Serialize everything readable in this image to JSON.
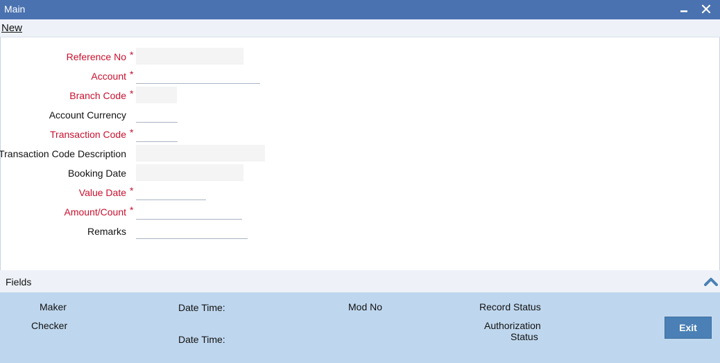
{
  "window": {
    "title": "Main",
    "minimize_icon": "minimize-icon",
    "close_icon": "close-icon"
  },
  "toolbar": {
    "new_label": "New"
  },
  "form": {
    "reference_no": {
      "label": "Reference No",
      "required": true,
      "value": ""
    },
    "account": {
      "label": "Account",
      "required": true,
      "value": ""
    },
    "branch_code": {
      "label": "Branch Code",
      "required": true,
      "value": ""
    },
    "account_currency": {
      "label": "Account Currency",
      "required": false,
      "value": ""
    },
    "transaction_code": {
      "label": "Transaction Code",
      "required": true,
      "value": ""
    },
    "transaction_code_description": {
      "label": "Transaction Code Description",
      "required": false,
      "value": ""
    },
    "booking_date": {
      "label": "Booking Date",
      "required": false,
      "value": ""
    },
    "value_date": {
      "label": "Value Date",
      "required": true,
      "value": ""
    },
    "amount_count": {
      "label": "Amount/Count",
      "required": true,
      "value": ""
    },
    "remarks": {
      "label": "Remarks",
      "required": false,
      "value": ""
    },
    "required_mark": "*"
  },
  "fields_bar": {
    "label": "Fields",
    "icon": "chevron-up-icon"
  },
  "audit": {
    "maker": "Maker",
    "checker": "Checker",
    "date_time_1": "Date Time:",
    "date_time_2": "Date Time:",
    "mod_no": "Mod No",
    "record_status": "Record Status",
    "authorization": "Authorization",
    "status": "Status",
    "exit_label": "Exit"
  },
  "colors": {
    "title_bar": "#4a72b0",
    "required_label": "#c8102e",
    "audit_panel": "#bfd7ee",
    "exit_button": "#4a80b5"
  }
}
